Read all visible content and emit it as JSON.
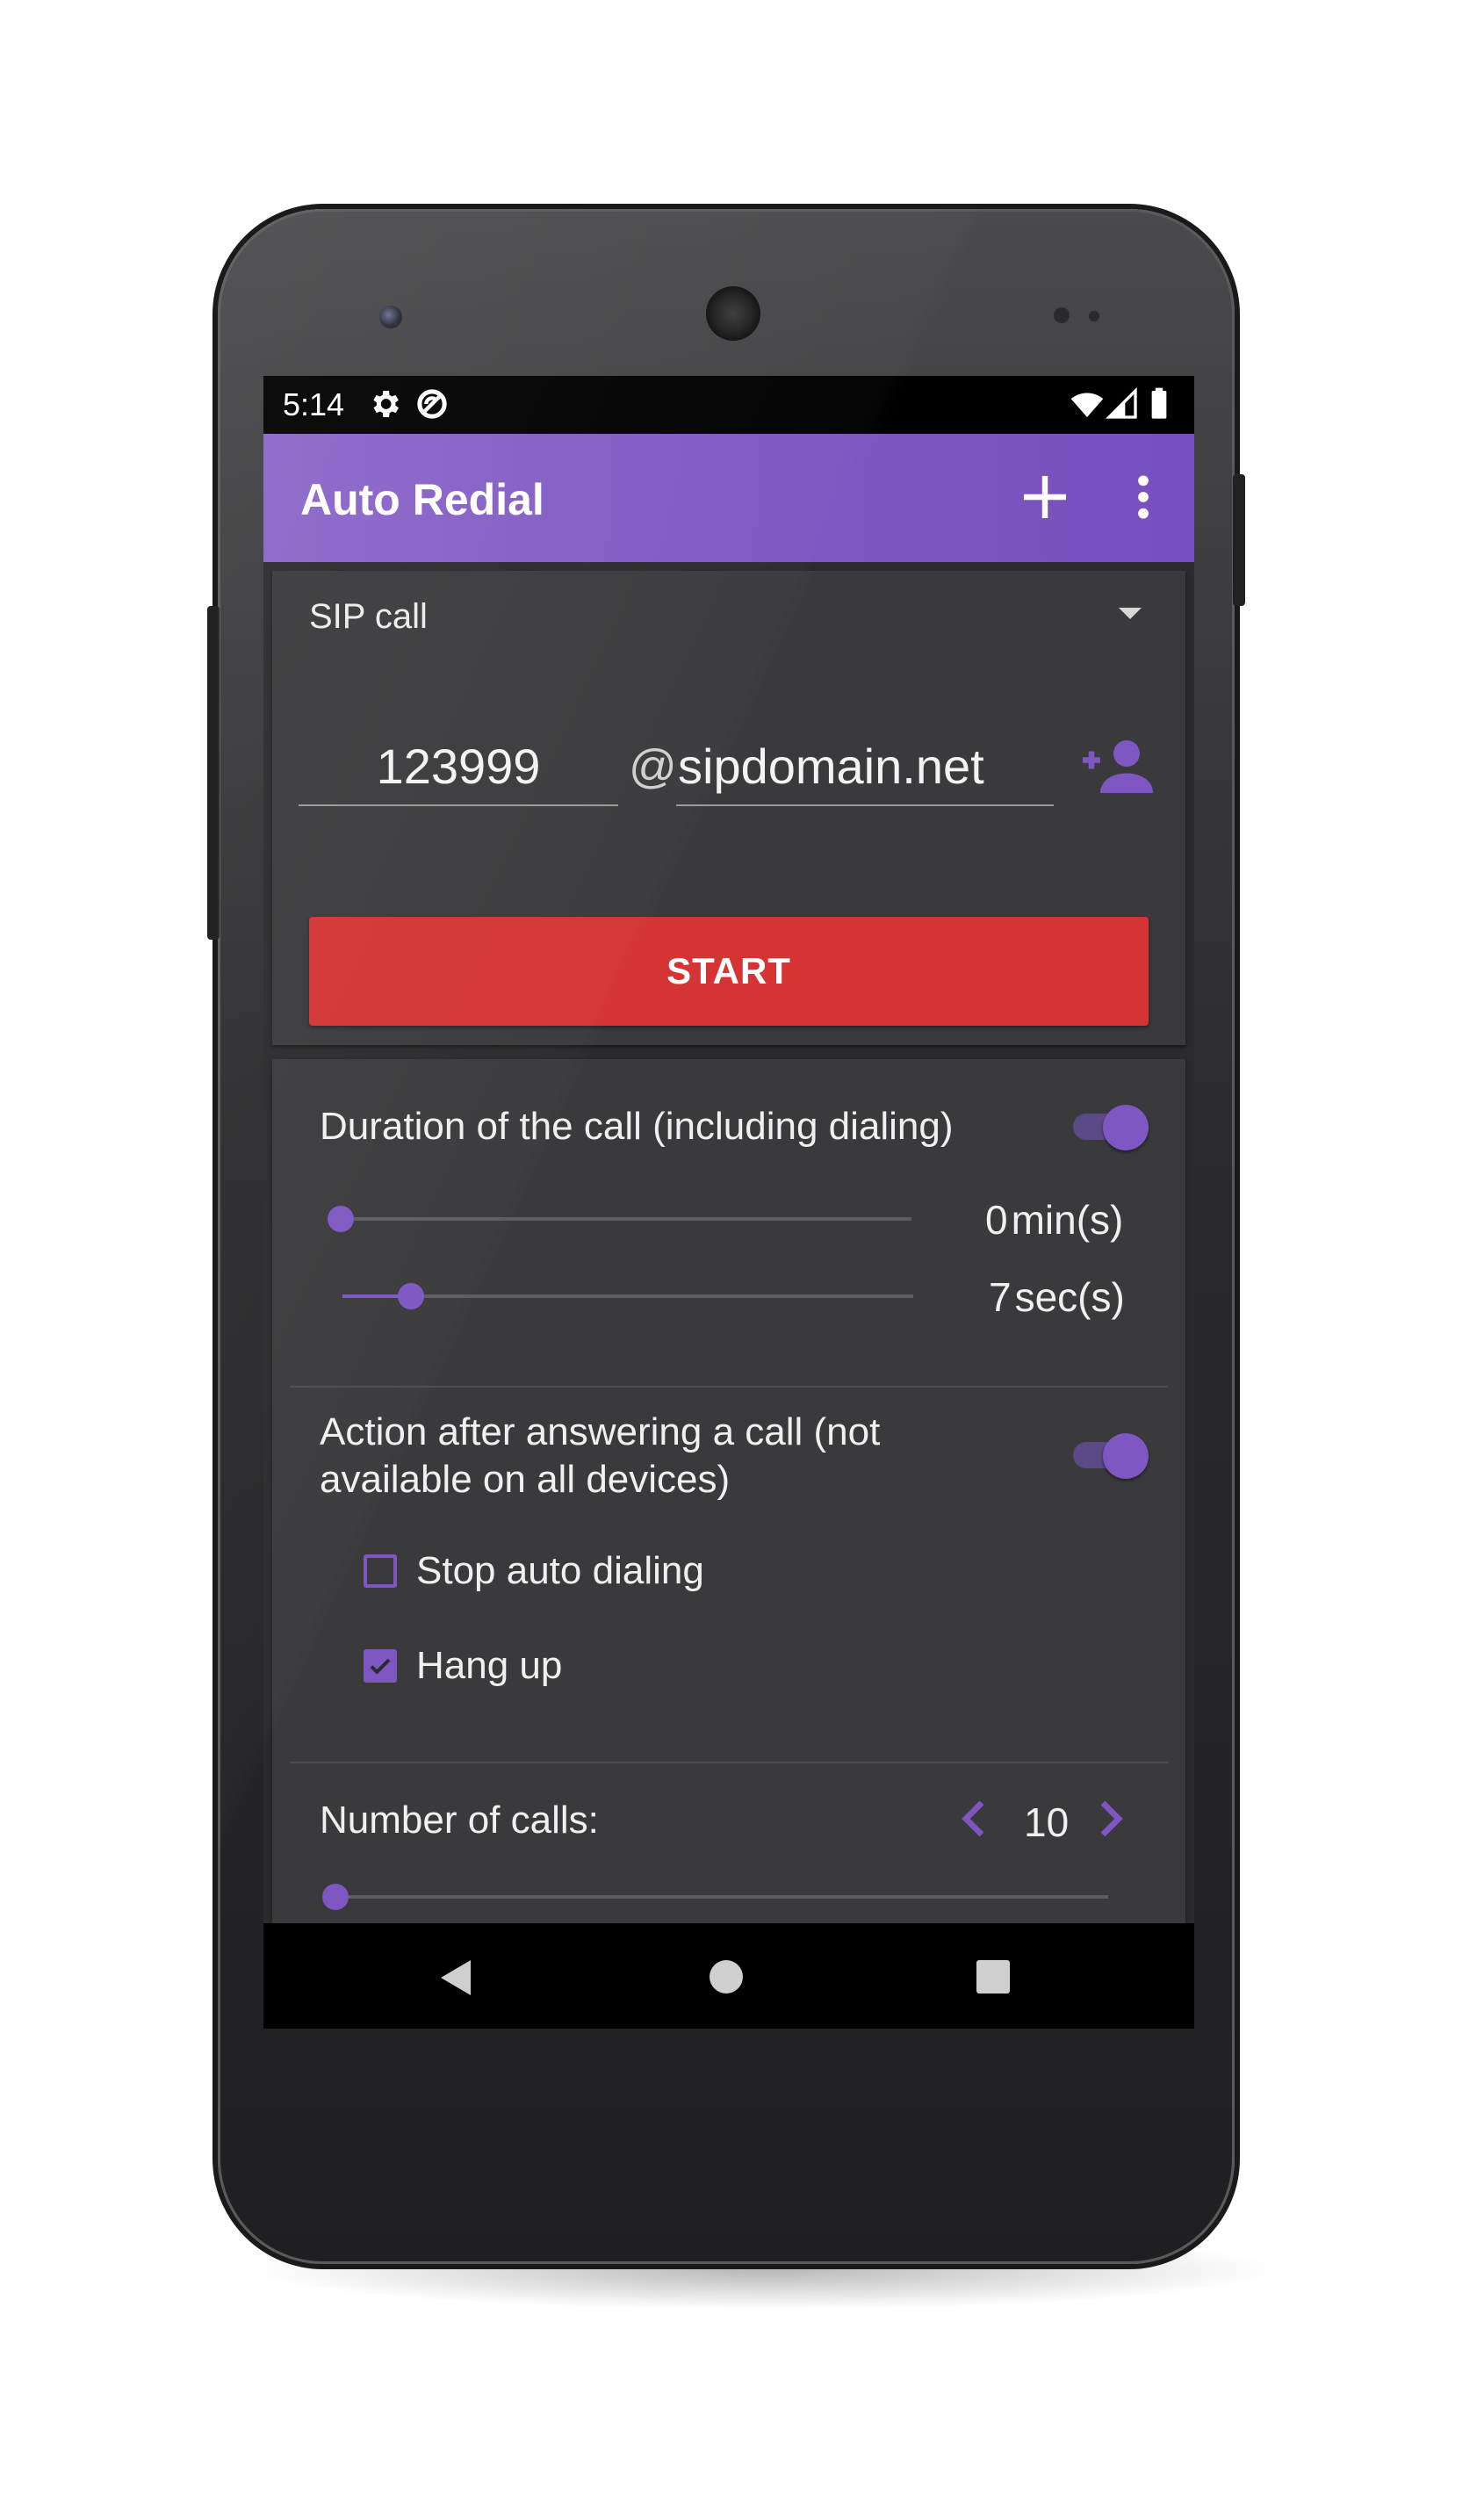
{
  "status_bar": {
    "time": "5:14",
    "left_icons": [
      "gear-icon",
      "do-not-disturb-icon"
    ],
    "right_icons": [
      "wifi-icon",
      "signal-icon",
      "battery-icon"
    ]
  },
  "app_bar": {
    "title": "Auto Redial",
    "actions": [
      "add-icon",
      "more-vert-icon"
    ],
    "color": "#7e57c2"
  },
  "call_card": {
    "call_type": "SIP call",
    "number": "123999",
    "at": "@",
    "domain": "sipdomain.net",
    "start_label": "START",
    "start_color": "#d43434"
  },
  "settings": {
    "duration": {
      "label": "Duration of the call (including dialing)",
      "enabled": true,
      "minutes": {
        "value": "0",
        "unit": "min(s)",
        "level": 0.0
      },
      "seconds": {
        "value": "7",
        "unit": "sec(s)",
        "level": 0.12
      }
    },
    "action_after_answer": {
      "label": "Action after answering a call (not available on all devices)",
      "line1": "Action after answering a call (not",
      "line2": "available on all devices)",
      "enabled": true,
      "options": [
        {
          "label": "Stop auto dialing",
          "checked": false
        },
        {
          "label": "Hang up",
          "checked": true
        }
      ]
    },
    "number_of_calls": {
      "label": "Number of calls:",
      "value": "10",
      "level": 0.0
    }
  },
  "nav_bar": {
    "buttons": [
      "back-icon",
      "home-icon",
      "recents-icon"
    ]
  }
}
